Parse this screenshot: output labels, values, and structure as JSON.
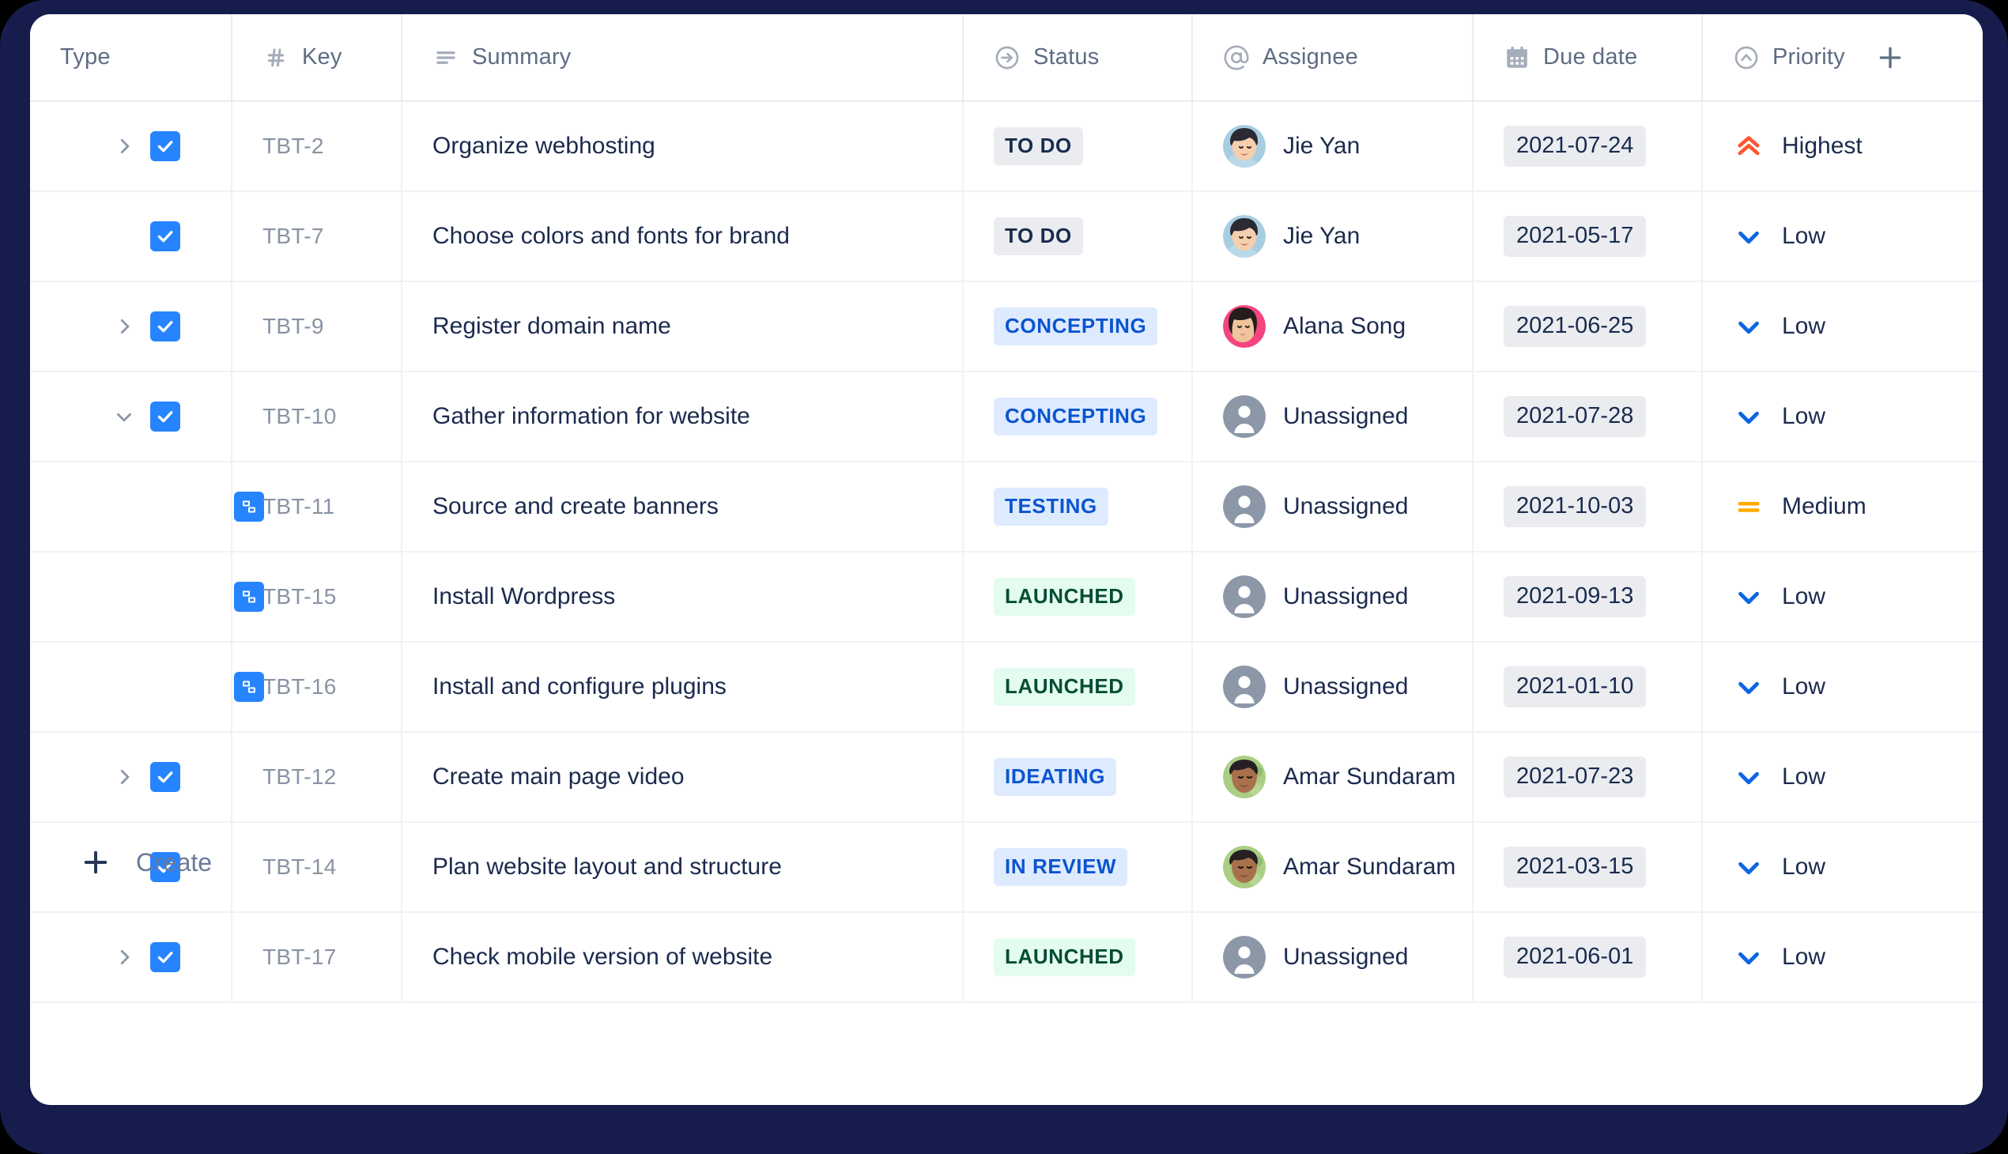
{
  "table": {
    "columns": [
      {
        "id": "type",
        "label": "Type",
        "icon": "none"
      },
      {
        "id": "key",
        "label": "Key",
        "icon": "hash-icon"
      },
      {
        "id": "summary",
        "label": "Summary",
        "icon": "lines-icon"
      },
      {
        "id": "status",
        "label": "Status",
        "icon": "arrow-circle-right-icon"
      },
      {
        "id": "assignee",
        "label": "Assignee",
        "icon": "at-icon"
      },
      {
        "id": "due_date",
        "label": "Due date",
        "icon": "calendar-icon"
      },
      {
        "id": "priority",
        "label": "Priority",
        "icon": "chevron-up-circle-icon"
      }
    ],
    "add_column_icon": "plus-icon",
    "rows": [
      {
        "type_icon": "task-icon",
        "expander": "collapsed",
        "indent": false,
        "key": "TBT-2",
        "summary": "Organize webhosting",
        "status": "TO DO",
        "status_style": "grey",
        "assignee": "Jie Yan",
        "avatar": "jie-yan",
        "due_date": "2021-07-24",
        "priority": "Highest",
        "priority_icon": "highest-icon"
      },
      {
        "type_icon": "task-icon",
        "expander": "none",
        "indent": false,
        "key": "TBT-7",
        "summary": "Choose colors and fonts for brand",
        "status": "TO DO",
        "status_style": "grey",
        "assignee": "Jie Yan",
        "avatar": "jie-yan",
        "due_date": "2021-05-17",
        "priority": "Low",
        "priority_icon": "low-icon"
      },
      {
        "type_icon": "task-icon",
        "expander": "collapsed",
        "indent": false,
        "key": "TBT-9",
        "summary": "Register domain name",
        "status": "CONCEPTING",
        "status_style": "blue",
        "assignee": "Alana Song",
        "avatar": "alana-song",
        "due_date": "2021-06-25",
        "priority": "Low",
        "priority_icon": "low-icon"
      },
      {
        "type_icon": "task-icon",
        "expander": "expanded",
        "indent": false,
        "key": "TBT-10",
        "summary": "Gather information for website",
        "status": "CONCEPTING",
        "status_style": "blue",
        "assignee": "Unassigned",
        "avatar": "unassigned",
        "due_date": "2021-07-28",
        "priority": "Low",
        "priority_icon": "low-icon"
      },
      {
        "type_icon": "subtask-icon",
        "expander": "none",
        "indent": true,
        "key": "TBT-11",
        "summary": "Source and create banners",
        "status": "TESTING",
        "status_style": "blue",
        "assignee": "Unassigned",
        "avatar": "unassigned",
        "due_date": "2021-10-03",
        "priority": "Medium",
        "priority_icon": "medium-icon"
      },
      {
        "type_icon": "subtask-icon",
        "expander": "none",
        "indent": true,
        "key": "TBT-15",
        "summary": "Install Wordpress",
        "status": "LAUNCHED",
        "status_style": "green",
        "assignee": "Unassigned",
        "avatar": "unassigned",
        "due_date": "2021-09-13",
        "priority": "Low",
        "priority_icon": "low-icon"
      },
      {
        "type_icon": "subtask-icon",
        "expander": "none",
        "indent": true,
        "key": "TBT-16",
        "summary": "Install and configure plugins",
        "status": "LAUNCHED",
        "status_style": "green",
        "assignee": "Unassigned",
        "avatar": "unassigned",
        "due_date": "2021-01-10",
        "priority": "Low",
        "priority_icon": "low-icon"
      },
      {
        "type_icon": "task-icon",
        "expander": "collapsed",
        "indent": false,
        "key": "TBT-12",
        "summary": "Create main page video",
        "status": "IDEATING",
        "status_style": "blue",
        "assignee": "Amar Sundaram",
        "avatar": "amar-sundaram",
        "due_date": "2021-07-23",
        "priority": "Low",
        "priority_icon": "low-icon"
      },
      {
        "type_icon": "task-icon",
        "expander": "none",
        "indent": false,
        "key": "TBT-14",
        "summary": "Plan website layout and structure",
        "status": "IN REVIEW",
        "status_style": "blue",
        "assignee": "Amar Sundaram",
        "avatar": "amar-sundaram",
        "due_date": "2021-03-15",
        "priority": "Low",
        "priority_icon": "low-icon"
      },
      {
        "type_icon": "task-icon",
        "expander": "collapsed",
        "indent": false,
        "key": "TBT-17",
        "summary": "Check mobile version of website",
        "status": "LAUNCHED",
        "status_style": "green",
        "assignee": "Unassigned",
        "avatar": "unassigned",
        "due_date": "2021-06-01",
        "priority": "Low",
        "priority_icon": "low-icon"
      }
    ]
  },
  "create": {
    "label": "Create",
    "icon": "plus-icon"
  },
  "colors": {
    "frame": "#161C4C",
    "card": "#FFFFFF",
    "accent_blue": "#2684FF",
    "status_grey_bg": "#EBECF0",
    "status_grey_text": "#172B4D",
    "status_blue_bg": "#DEEBFF",
    "status_blue_text": "#0B54D0",
    "status_green_bg": "#E3FCEF",
    "status_green_text": "#064C35",
    "priority_highest": "#FF5630",
    "priority_medium": "#FFAB00",
    "priority_low": "#0C66E4",
    "header_text": "#5E6C84",
    "body_text": "#1B2A4E",
    "key_text": "#8993A4"
  }
}
